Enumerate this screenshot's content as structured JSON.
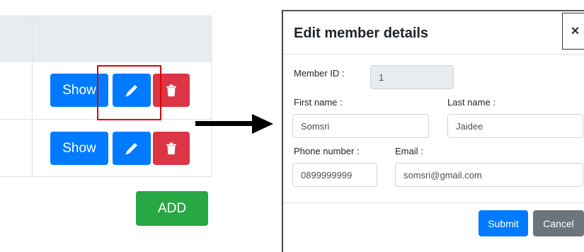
{
  "table": {
    "rows": [
      {
        "show_label": "Show"
      },
      {
        "show_label": "Show"
      }
    ],
    "add_label": "ADD"
  },
  "modal": {
    "title": "Edit member details",
    "close_label": "×",
    "fields": {
      "member_id": {
        "label": "Member ID :",
        "value": "1"
      },
      "first_name": {
        "label": "First name :",
        "value": "Somsri"
      },
      "last_name": {
        "label": "Last name :",
        "value": "Jaidee"
      },
      "phone": {
        "label": "Phone number :",
        "value": "0899999999"
      },
      "email": {
        "label": "Email :",
        "value": "somsri@gmail.com"
      }
    },
    "submit_label": "Submit",
    "cancel_label": "Cancel"
  },
  "colors": {
    "primary": "#007bff",
    "danger": "#dc3545",
    "success": "#28a745",
    "secondary": "#6c757d",
    "highlight": "#e00000"
  }
}
